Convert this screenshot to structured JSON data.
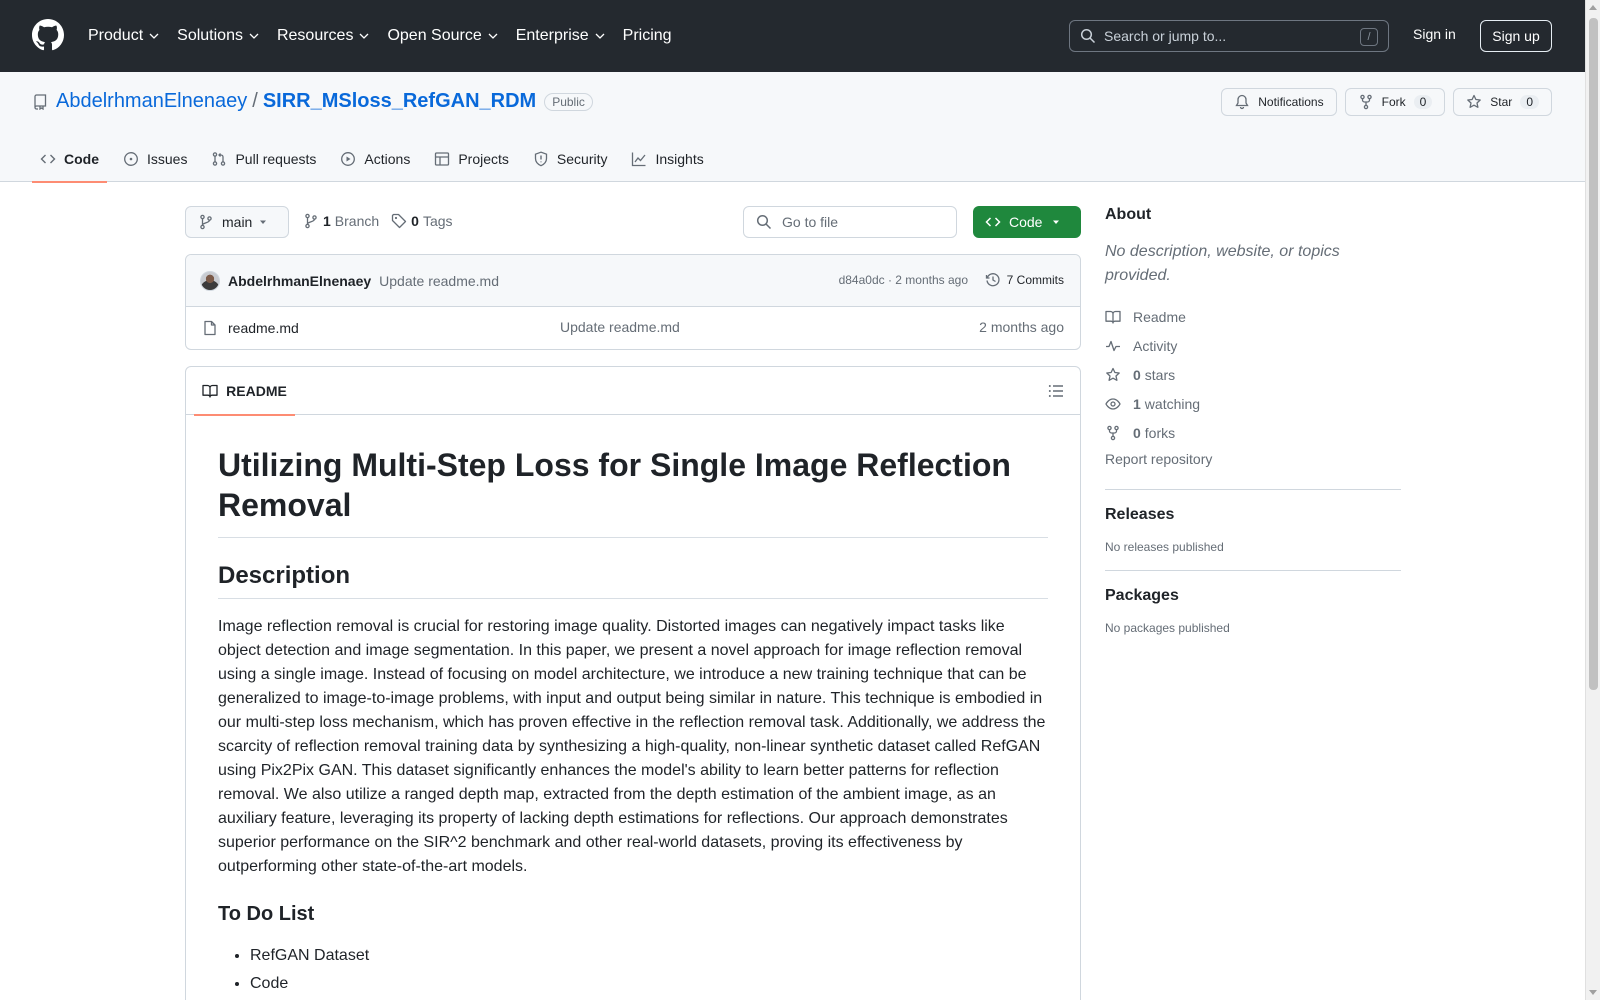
{
  "header": {
    "nav": [
      "Product",
      "Solutions",
      "Resources",
      "Open Source",
      "Enterprise",
      "Pricing"
    ],
    "search_placeholder": "Search or jump to...",
    "search_shortcut": "/",
    "signin": "Sign in",
    "signup": "Sign up"
  },
  "repo": {
    "owner": "AbdelrhmanElnenaey",
    "separator": "/",
    "name": "SIRR_MSloss_RefGAN_RDM",
    "visibility": "Public",
    "notifications_label": "Notifications",
    "fork_label": "Fork",
    "fork_count": "0",
    "star_label": "Star",
    "star_count": "0",
    "tabs": [
      "Code",
      "Issues",
      "Pull requests",
      "Actions",
      "Projects",
      "Security",
      "Insights"
    ]
  },
  "file_nav": {
    "branch": "main",
    "branch_count": "1",
    "branch_label": "Branch",
    "tag_count": "0",
    "tag_label": "Tags",
    "goto_placeholder": "Go to file",
    "code_label": "Code"
  },
  "commit": {
    "author": "AbdelrhmanElnenaey",
    "message": "Update readme.md",
    "meta": "d84a0dc · 2 months ago",
    "count_label": "7 Commits"
  },
  "files": [
    {
      "name": "readme.md",
      "commit": "Update readme.md",
      "date": "2 months ago"
    }
  ],
  "readme": {
    "tab_label": "README",
    "title": "Utilizing Multi-Step Loss for Single Image Reflection Removal",
    "h2": "Description",
    "paragraph": "Image reflection removal is crucial for restoring image quality. Distorted images can negatively impact tasks like object detection and image segmentation. In this paper, we present a novel approach for image reflection removal using a single image. Instead of focusing on model architecture, we introduce a new training technique that can be generalized to image-to-image problems, with input and output being similar in nature. This technique is embodied in our multi-step loss mechanism, which has proven effective in the reflection removal task. Additionally, we address the scarcity of reflection removal training data by synthesizing a high-quality, non-linear synthetic dataset called RefGAN using Pix2Pix GAN. This dataset significantly enhances the model's ability to learn better patterns for reflection removal. We also utilize a ranged depth map, extracted from the depth estimation of the ambient image, as an auxiliary feature, leveraging its property of lacking depth estimations for reflections. Our approach demonstrates superior performance on the SIR^2 benchmark and other real-world datasets, proving its effectiveness by outperforming other state-of-the-art models.",
    "h3": "To Do List",
    "todo": [
      "RefGAN Dataset",
      "Code"
    ]
  },
  "about": {
    "title": "About",
    "description": "No description, website, or topics provided.",
    "readme": "Readme",
    "activity": "Activity",
    "stars_count": "0",
    "stars_label": "stars",
    "watching_count": "1",
    "watching_label": "watching",
    "forks_count": "0",
    "forks_label": "forks",
    "report": "Report repository"
  },
  "releases": {
    "title": "Releases",
    "note": "No releases published"
  },
  "packages": {
    "title": "Packages",
    "note": "No packages published"
  },
  "colors": {
    "header_bg": "#24292f",
    "link": "#0969da",
    "primary_button": "#1f883d",
    "tab_underline": "#fd8c73"
  }
}
